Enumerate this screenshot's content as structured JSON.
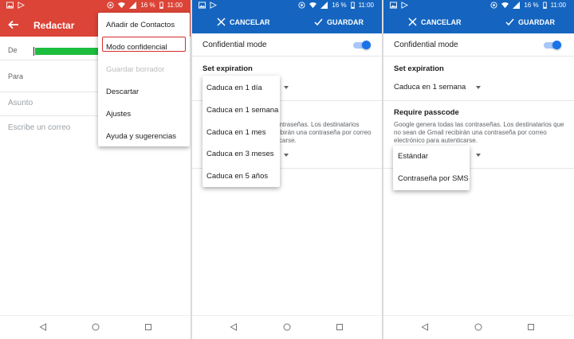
{
  "status_bar": {
    "battery": "16 %",
    "time": "11:00"
  },
  "compose": {
    "title": "Redactar",
    "from_label": "De",
    "to_label": "Para",
    "subject_placeholder": "Asunto",
    "body_placeholder": "Escribe un correo",
    "menu": [
      {
        "label": "Añadir de Contactos",
        "enabled": true
      },
      {
        "label": "Modo confidencial",
        "enabled": true,
        "highlighted": true
      },
      {
        "label": "Guardar borrador",
        "enabled": false
      },
      {
        "label": "Descartar",
        "enabled": true
      },
      {
        "label": "Ajustes",
        "enabled": true
      },
      {
        "label": "Ayuda y sugerencias",
        "enabled": true
      }
    ]
  },
  "confidential": {
    "cancel_label": "CANCELAR",
    "save_label": "GUARDAR",
    "mode_label": "Confidential mode",
    "mode_enabled": true,
    "expiration_title": "Set expiration",
    "expiration_value": "Caduca en 1 semana",
    "expiration_options": [
      "Caduca en 1 día",
      "Caduca en 1 semana",
      "Caduca en 1 mes",
      "Caduca en 3 meses",
      "Caduca en 5 años"
    ],
    "passcode_title": "Require passcode",
    "passcode_desc": "Google genera todas las contraseñas. Los destinatarios que no sean de Gmail recibirán una contraseña por correo electrónico para autenticarse.",
    "passcode_desc_partial_1": "ontraseñas. Los destinatarios",
    "passcode_desc_partial_2": "cibirán una contraseña por correo",
    "passcode_desc_partial_3": "ticarse.",
    "passcode_options": [
      "Estándar",
      "Contraseña por SMS"
    ]
  },
  "colors": {
    "gmail_red": "#db4437",
    "blue_header": "#1a73e8",
    "highlight_border": "#d32f2f",
    "from_green": "#1dbd3e"
  }
}
